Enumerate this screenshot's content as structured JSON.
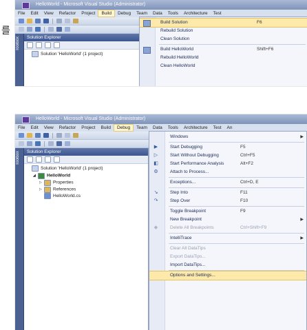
{
  "shot1": {
    "title": "HelloWorld - Microsoft Visual Studio (Administrator)",
    "menu": [
      "File",
      "Edit",
      "View",
      "Refactor",
      "Project",
      "Build",
      "Debug",
      "Team",
      "Data",
      "Tools",
      "Architecture",
      "Test"
    ],
    "active_menu": "Build",
    "explorer_title": "Solution Explorer",
    "sidebar_label": "Toolbox",
    "tree": [
      {
        "label": "Solution 'HelloWorld' (1 project)"
      }
    ],
    "build_menu": [
      {
        "label": "Build Solution",
        "shortcut": "F6",
        "highlight": true,
        "icon": "build-icon"
      },
      {
        "label": "Rebuild Solution",
        "shortcut": ""
      },
      {
        "label": "Clean Solution",
        "shortcut": ""
      },
      {
        "sep": true
      },
      {
        "label": "Build HelloWorld",
        "shortcut": "Shift+F6",
        "icon": "build-project-icon"
      },
      {
        "label": "Rebuild HelloWorld",
        "shortcut": ""
      },
      {
        "label": "Clean HelloWorld",
        "shortcut": ""
      }
    ]
  },
  "korean_text": "를",
  "shot2": {
    "title": "HelloWorld - Microsoft Visual Studio (Administrator)",
    "menu": [
      "File",
      "Edit",
      "View",
      "Refactor",
      "Project",
      "Build",
      "Debug",
      "Team",
      "Data",
      "Tools",
      "Architecture",
      "Test",
      "An"
    ],
    "active_menu": "Debug",
    "explorer_title": "Solution Explorer",
    "sidebar_label": "Toolbox",
    "tree": [
      {
        "label": "Solution 'HelloWorld' (1 project)",
        "indent": 0,
        "icon": "solution-icon",
        "arrow": ""
      },
      {
        "label": "HelloWorld",
        "indent": 1,
        "icon": "csharp-project-icon",
        "arrow": "◢",
        "bold": true
      },
      {
        "label": "Properties",
        "indent": 2,
        "icon": "properties-folder-icon",
        "arrow": "▷"
      },
      {
        "label": "References",
        "indent": 2,
        "icon": "references-folder-icon",
        "arrow": "▷"
      },
      {
        "label": "HelloWorld.cs",
        "indent": 2,
        "icon": "csharp-file-icon",
        "arrow": ""
      }
    ],
    "debug_menu": [
      {
        "label": "Windows",
        "shortcut": "",
        "submenu": true
      },
      {
        "sep": true
      },
      {
        "label": "Start Debugging",
        "shortcut": "F5",
        "icon": "play-icon",
        "glyph": "▶"
      },
      {
        "label": "Start Without Debugging",
        "shortcut": "Ctrl+F5",
        "icon": "play-outline-icon",
        "glyph": "▷"
      },
      {
        "label": "Start Performance Analysis",
        "shortcut": "Alt+F2",
        "icon": "performance-icon",
        "glyph": "◧"
      },
      {
        "label": "Attach to Process...",
        "shortcut": "",
        "icon": "attach-icon",
        "glyph": "⚙"
      },
      {
        "sep": true
      },
      {
        "label": "Exceptions...",
        "shortcut": "Ctrl+D, E"
      },
      {
        "sep": true
      },
      {
        "label": "Step Into",
        "shortcut": "F11",
        "icon": "step-into-icon",
        "glyph": "↘"
      },
      {
        "label": "Step Over",
        "shortcut": "F10",
        "icon": "step-over-icon",
        "glyph": "↷"
      },
      {
        "sep": true
      },
      {
        "label": "Toggle Breakpoint",
        "shortcut": "F9"
      },
      {
        "label": "New Breakpoint",
        "shortcut": "",
        "submenu": true
      },
      {
        "label": "Delete All Breakpoints",
        "shortcut": "Ctrl+Shift+F9",
        "disabled": true,
        "icon": "delete-breakpoints-icon",
        "glyph": "◆"
      },
      {
        "sep": true
      },
      {
        "label": "IntelliTrace",
        "shortcut": "",
        "submenu": true
      },
      {
        "sep": true
      },
      {
        "label": "Clear All DataTips",
        "shortcut": "",
        "disabled": true
      },
      {
        "label": "Export DataTips...",
        "shortcut": "",
        "disabled": true
      },
      {
        "label": "Import DataTips...",
        "shortcut": ""
      },
      {
        "sep": true
      },
      {
        "label": "Options and Settings...",
        "shortcut": "",
        "highlight": true
      }
    ]
  },
  "colors": {
    "title_bar": "#7f93b9",
    "menu_highlight": "#fde9a9",
    "explorer_header": "#3c5590"
  }
}
